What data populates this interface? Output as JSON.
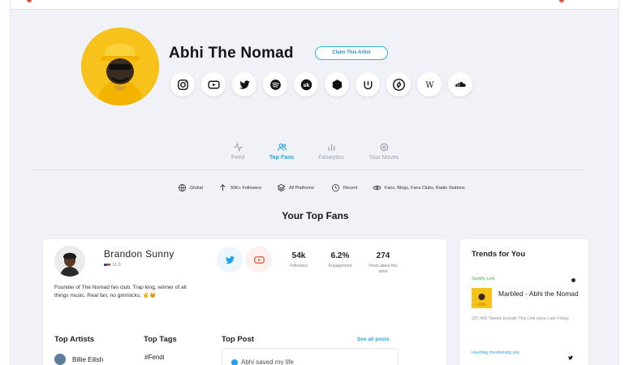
{
  "profile": {
    "name": "Abhi The Nomad",
    "claim_label": "Claim This Artist",
    "socials": [
      "instagram-icon",
      "youtube-icon",
      "twitter-icon",
      "spotify-icon",
      "songkick-icon",
      "bandsintown-icon",
      "genius-icon",
      "shazam-icon",
      "wikipedia-icon",
      "soundcloud-icon"
    ]
  },
  "tabs": [
    {
      "label": "Feed",
      "active": false
    },
    {
      "label": "Top Fans",
      "active": true
    },
    {
      "label": "Fanalytics",
      "active": false
    },
    {
      "label": "Your Moves",
      "active": false
    }
  ],
  "filters": {
    "region": "Global",
    "followers": "50K+ Followers",
    "platforms": "All Platforms",
    "time": "Recent",
    "types": "Fans, Blogs, Fans Clubs, Radio Stations"
  },
  "section_title": "Your Top Fans",
  "fan": {
    "name": "Brandon Sunny",
    "location": "U.S",
    "stats": [
      {
        "value": "54k",
        "label": "Followers"
      },
      {
        "value": "6.2%",
        "label": "Engagement"
      },
      {
        "value": "274",
        "label": "Posts about this artist"
      }
    ],
    "bio": "Founder of The Nomad fan club, Trap king, winner of all things music. Real fan, no gimmicks. ✌️😺",
    "top_artists_heading": "Top Artists",
    "top_tags_heading": "Top Tags",
    "top_post_heading": "Top Post",
    "see_all_label": "See all posts",
    "top_artist_1": "Billie Eilish",
    "top_tag_1": "#Fendi",
    "top_post_text": "Abhi saved my life"
  },
  "trends": {
    "title": "Trends for You",
    "item1": {
      "source": "Spotify Link",
      "name": "Marbled - Abhi the Nomad",
      "meta": "237,405 Tweets Include This Link since Last Friday"
    },
    "item2_source": "Hashtag mentioning you"
  },
  "colors": {
    "accent": "#2aa6e0",
    "avatar_bg": "#f7c21b",
    "spotify_green": "#3bb34a",
    "youtube_red": "#e0523b",
    "twitter_blue": "#1da1f2"
  }
}
